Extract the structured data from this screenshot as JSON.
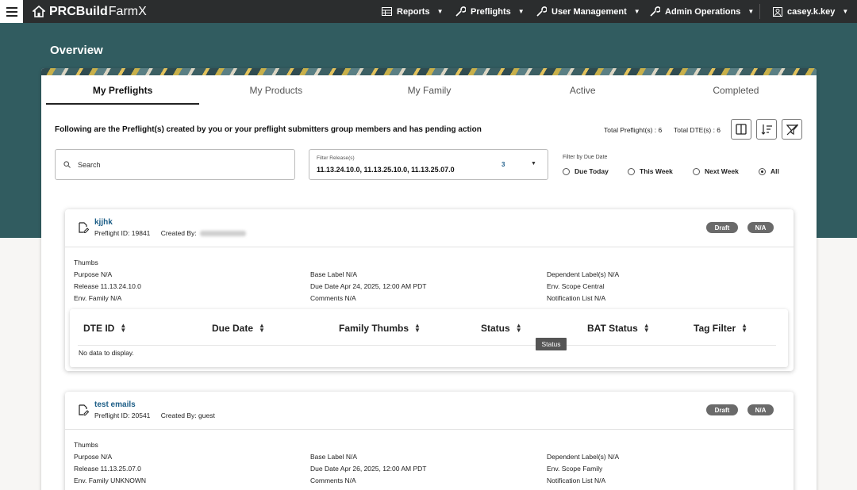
{
  "app": {
    "brand_bold": "PRCBuild",
    "brand_light": "FarmX"
  },
  "nav": {
    "reports": "Reports",
    "preflights": "Preflights",
    "user_management": "User Management",
    "admin_operations": "Admin Operations",
    "user": "casey.k.key"
  },
  "page": {
    "title": "Overview"
  },
  "tabs": [
    {
      "label": "My Preflights",
      "active": true
    },
    {
      "label": "My Products",
      "active": false
    },
    {
      "label": "My Family",
      "active": false
    },
    {
      "label": "Active",
      "active": false
    },
    {
      "label": "Completed",
      "active": false
    }
  ],
  "subheading": "Following are the Preflight(s) created by you or your preflight submitters group members and has pending action",
  "totals": {
    "preflights": "Total Preflight(s) : 6",
    "dtes": "Total DTE(s) : 6"
  },
  "search": {
    "label": "Search"
  },
  "release_filter": {
    "caption": "Filter Release(s)",
    "value": "11.13.24.10.0, 11.13.25.10.0, 11.13.25.07.0",
    "count": "3"
  },
  "due_filter": {
    "caption": "Filter by Due Date",
    "options": [
      {
        "label": "Due Today",
        "selected": false
      },
      {
        "label": "This Week",
        "selected": false
      },
      {
        "label": "Next Week",
        "selected": false
      },
      {
        "label": "All",
        "selected": true
      }
    ]
  },
  "cards": [
    {
      "name": "kjjhk",
      "preflight_id": "Preflight ID: 19841",
      "created_by": "Created By:",
      "created_by_redacted": true,
      "badges": [
        "Draft",
        "N/A"
      ],
      "col1": [
        "Thumbs",
        "Purpose N/A",
        "Release 11.13.24.10.0",
        "Env. Family N/A"
      ],
      "col2": [
        "Base Label N/A",
        "Due Date Apr 24, 2025, 12:00 AM PDT",
        "Comments N/A"
      ],
      "col3": [
        "Dependent Label(s) N/A",
        "Env. Scope Central",
        "Notification List N/A"
      ],
      "table": {
        "headers": [
          "DTE ID",
          "Due Date",
          "Family Thumbs",
          "Status",
          "BAT Status",
          "Tag Filter"
        ],
        "empty_text": "No data to display."
      }
    },
    {
      "name": "test emails",
      "preflight_id": "Preflight ID: 20541",
      "created_by": "Created By: guest",
      "created_by_redacted": false,
      "badges": [
        "Draft",
        "N/A"
      ],
      "col1": [
        "Thumbs",
        "Purpose N/A",
        "Release 11.13.25.07.0",
        "Env. Family UNKNOWN"
      ],
      "col2": [
        "Base Label N/A",
        "Due Date Apr 26, 2025, 12:00 AM PDT",
        "Comments N/A"
      ],
      "col3": [
        "Dependent Label(s) N/A",
        "Env. Scope Family",
        "Notification List N/A"
      ]
    }
  ],
  "tooltip": "Status",
  "icons": {
    "menu": "hamburger-icon",
    "home": "home-icon",
    "reports": "table-icon",
    "wrench": "wrench-icon",
    "search": "search-icon",
    "edit_doc": "edit-document-icon",
    "columns": "columns-icon",
    "sort": "sort-icon",
    "filter_clear": "filter-clear-icon"
  }
}
